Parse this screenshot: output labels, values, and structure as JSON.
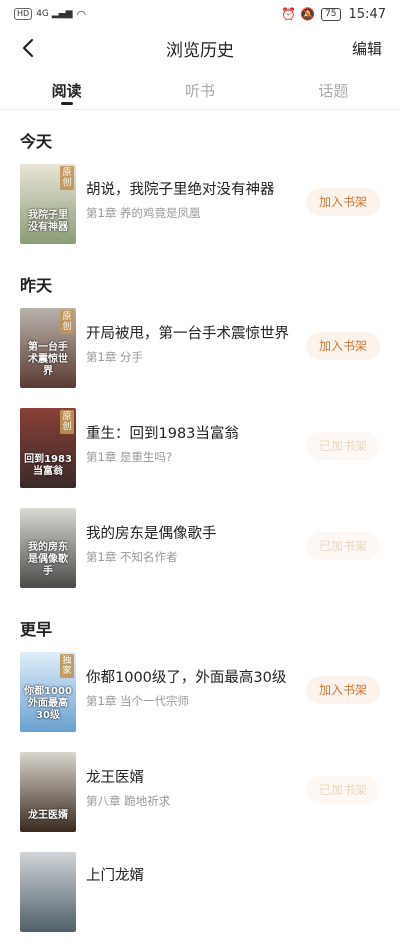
{
  "status_bar": {
    "left_hd": "HD",
    "left_signal": "4G",
    "battery": "75",
    "time": "15:47"
  },
  "nav": {
    "title": "浏览历史",
    "edit": "编辑"
  },
  "tabs": [
    {
      "label": "阅读",
      "active": true
    },
    {
      "label": "听书",
      "active": false
    },
    {
      "label": "话题",
      "active": false
    }
  ],
  "sections": [
    {
      "header": "今天",
      "books": [
        {
          "title": "胡说，我院子里绝对没有神器",
          "chapter": "第1章 养的鸡竟是凤凰",
          "button": "加入书架",
          "added": false,
          "tag": "原创",
          "cover_text": "我院子里没有神器",
          "cover_colors": [
            "#e9e4d6",
            "#8a9c76"
          ]
        }
      ]
    },
    {
      "header": "昨天",
      "books": [
        {
          "title": "开局被甩，第一台手术震惊世界",
          "chapter": "第1章 分手",
          "button": "加入书架",
          "added": false,
          "tag": "原创",
          "cover_text": "第一台手术震惊世界",
          "cover_colors": [
            "#b9b3ac",
            "#5a3a32"
          ]
        },
        {
          "title": "重生：回到1983当富翁",
          "chapter": "第1章 是重生吗?",
          "button": "已加书架",
          "added": true,
          "tag": "原创",
          "cover_text": "回到1983当富翁",
          "cover_colors": [
            "#8a4038",
            "#3a2a28"
          ]
        },
        {
          "title": "我的房东是偶像歌手",
          "chapter": "第1章 不知名作者",
          "button": "已加书架",
          "added": true,
          "tag": "",
          "cover_text": "我的房东是偶像歌手",
          "cover_colors": [
            "#d9d8d2",
            "#4a4a48"
          ]
        }
      ]
    },
    {
      "header": "更早",
      "books": [
        {
          "title": "你都1000级了，外面最高30级",
          "chapter": "第1章 当个一代宗师",
          "button": "加入书架",
          "added": false,
          "tag": "独家",
          "cover_text": "你都1000外面最高30级",
          "cover_colors": [
            "#dfeef8",
            "#6aa0d0"
          ]
        },
        {
          "title": "龙王医婿",
          "chapter": "第八章 跪地祈求",
          "button": "已加书架",
          "added": true,
          "tag": "",
          "cover_text": "龙王医婿",
          "cover_colors": [
            "#d8d4cc",
            "#3a2a20"
          ]
        },
        {
          "title": "上门龙婿",
          "chapter": "",
          "button": "",
          "added": false,
          "tag": "",
          "cover_text": "",
          "cover_colors": [
            "#d0d4d8",
            "#50606a"
          ]
        }
      ]
    }
  ]
}
